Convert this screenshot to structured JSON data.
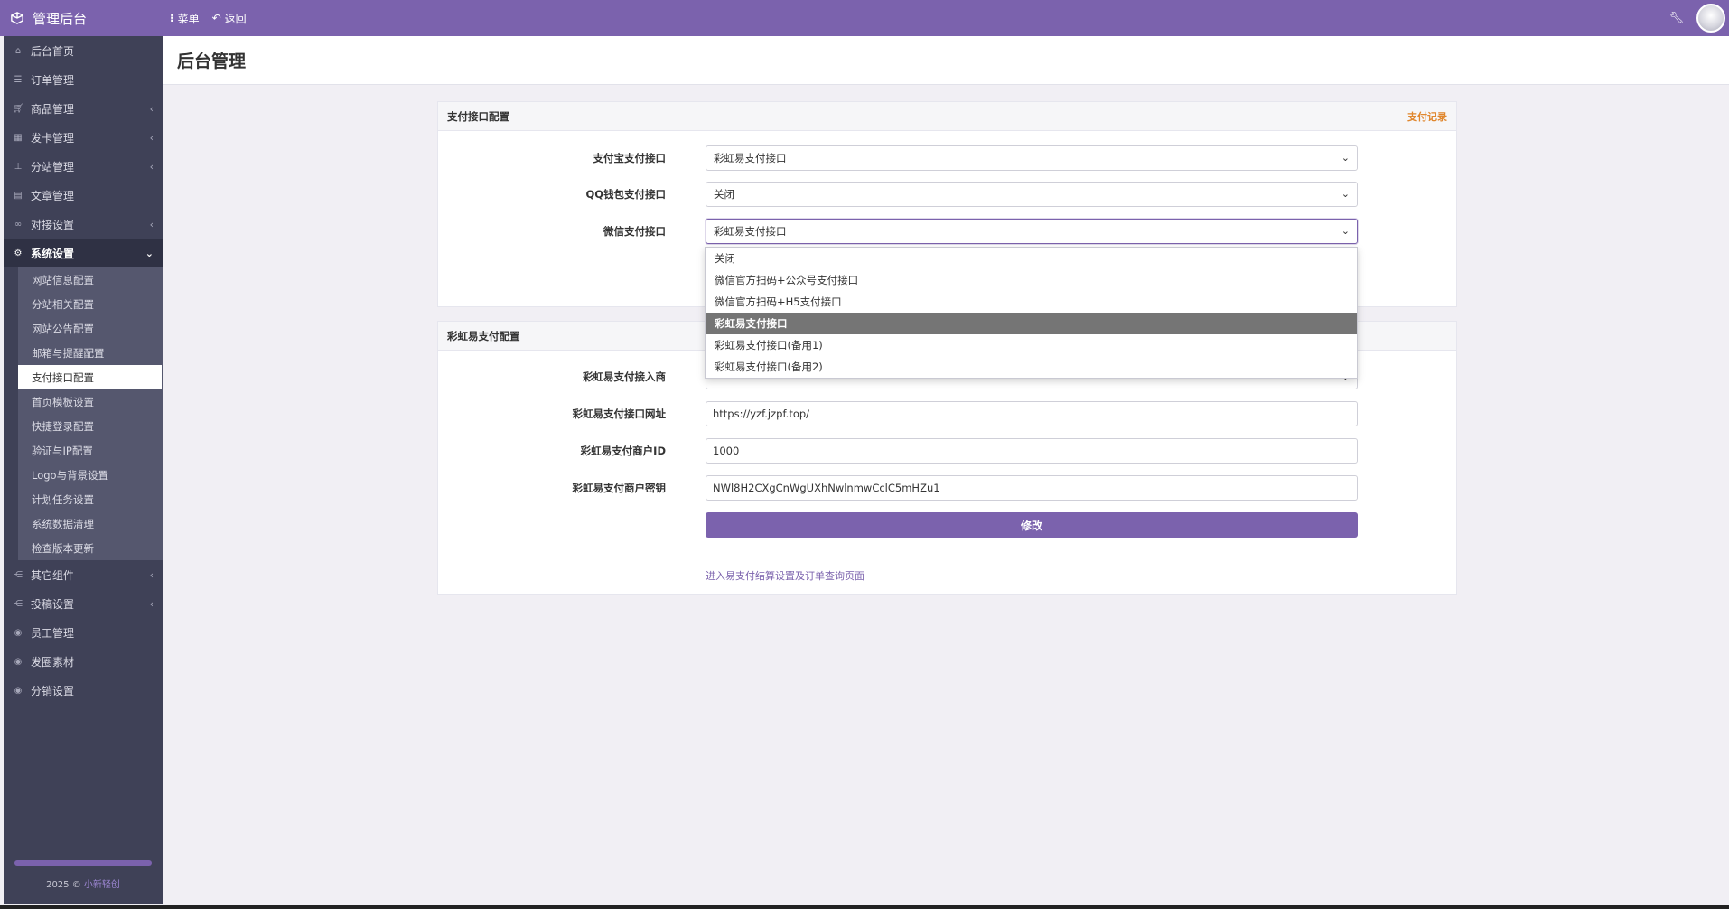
{
  "topbar": {
    "brand_title": "管理后台",
    "menu_label": "菜单",
    "back_label": "返回"
  },
  "sidebar": {
    "items_top": [
      {
        "label": "后台首页",
        "icon": "home-icon",
        "has_arrow": false
      },
      {
        "label": "订单管理",
        "icon": "list-icon",
        "has_arrow": false
      },
      {
        "label": "商品管理",
        "icon": "cart-icon",
        "has_arrow": true
      },
      {
        "label": "发卡管理",
        "icon": "grid-icon",
        "has_arrow": true
      },
      {
        "label": "分站管理",
        "icon": "sitemap-icon",
        "has_arrow": true
      },
      {
        "label": "文章管理",
        "icon": "book-icon",
        "has_arrow": false
      },
      {
        "label": "对接设置",
        "icon": "connect-icon",
        "has_arrow": true
      }
    ],
    "active_section": {
      "label": "系统设置",
      "icon": "gear-icon"
    },
    "sub_items": [
      "网站信息配置",
      "分站相关配置",
      "网站公告配置",
      "邮箱与提醒配置",
      "支付接口配置",
      "首页模板设置",
      "快捷登录配置",
      "验证与IP配置",
      "Logo与背景设置",
      "计划任务设置",
      "系统数据清理",
      "检查版本更新"
    ],
    "current_sub": "支付接口配置",
    "items_bottom": [
      {
        "label": "其它组件",
        "icon": "share-icon",
        "has_arrow": true
      },
      {
        "label": "投稿设置",
        "icon": "share-icon",
        "has_arrow": true
      },
      {
        "label": "员工管理",
        "icon": "user-circle-icon",
        "has_arrow": false
      },
      {
        "label": "发圈素材",
        "icon": "user-circle-icon",
        "has_arrow": false
      },
      {
        "label": "分销设置",
        "icon": "user-circle-icon",
        "has_arrow": false
      }
    ],
    "footer_prefix": "2025 ©",
    "footer_link": "小新轻创"
  },
  "header": {
    "page_title": "后台管理"
  },
  "payment_panel": {
    "title": "支付接口配置",
    "record_link": "支付记录",
    "rows": [
      {
        "label": "支付宝支付接口",
        "value": "彩虹易支付接口"
      },
      {
        "label": "QQ钱包支付接口",
        "value": "关闭"
      },
      {
        "label": "微信支付接口",
        "value": "彩虹易支付接口"
      }
    ]
  },
  "dropdown": {
    "options": [
      "关闭",
      "微信官方扫码+公众号支付接口",
      "微信官方扫码+H5支付接口",
      "彩虹易支付接口",
      "彩虹易支付接口(备用1)",
      "彩虹易支付接口(备用2)"
    ],
    "selected": "彩虹易支付接口"
  },
  "epay_panel": {
    "title": "彩虹易支付配置",
    "provider_label": "彩虹易支付接入商",
    "url_label": "彩虹易支付接口网址",
    "url_value": "https://yzf.jzpf.top/",
    "merchant_label": "彩虹易支付商户ID",
    "merchant_value": "1000",
    "key_label": "彩虹易支付商户密钥",
    "key_value": "NWl8H2CXgCnWgUXhNwlnmwCclC5mHZu1",
    "submit_label": "修改",
    "bottom_link": "进入易支付结算设置及订单查询页面"
  },
  "colors": {
    "accent": "#7b62ad",
    "sidebar_bg": "#3f4157",
    "link_orange": "#e0872e"
  }
}
